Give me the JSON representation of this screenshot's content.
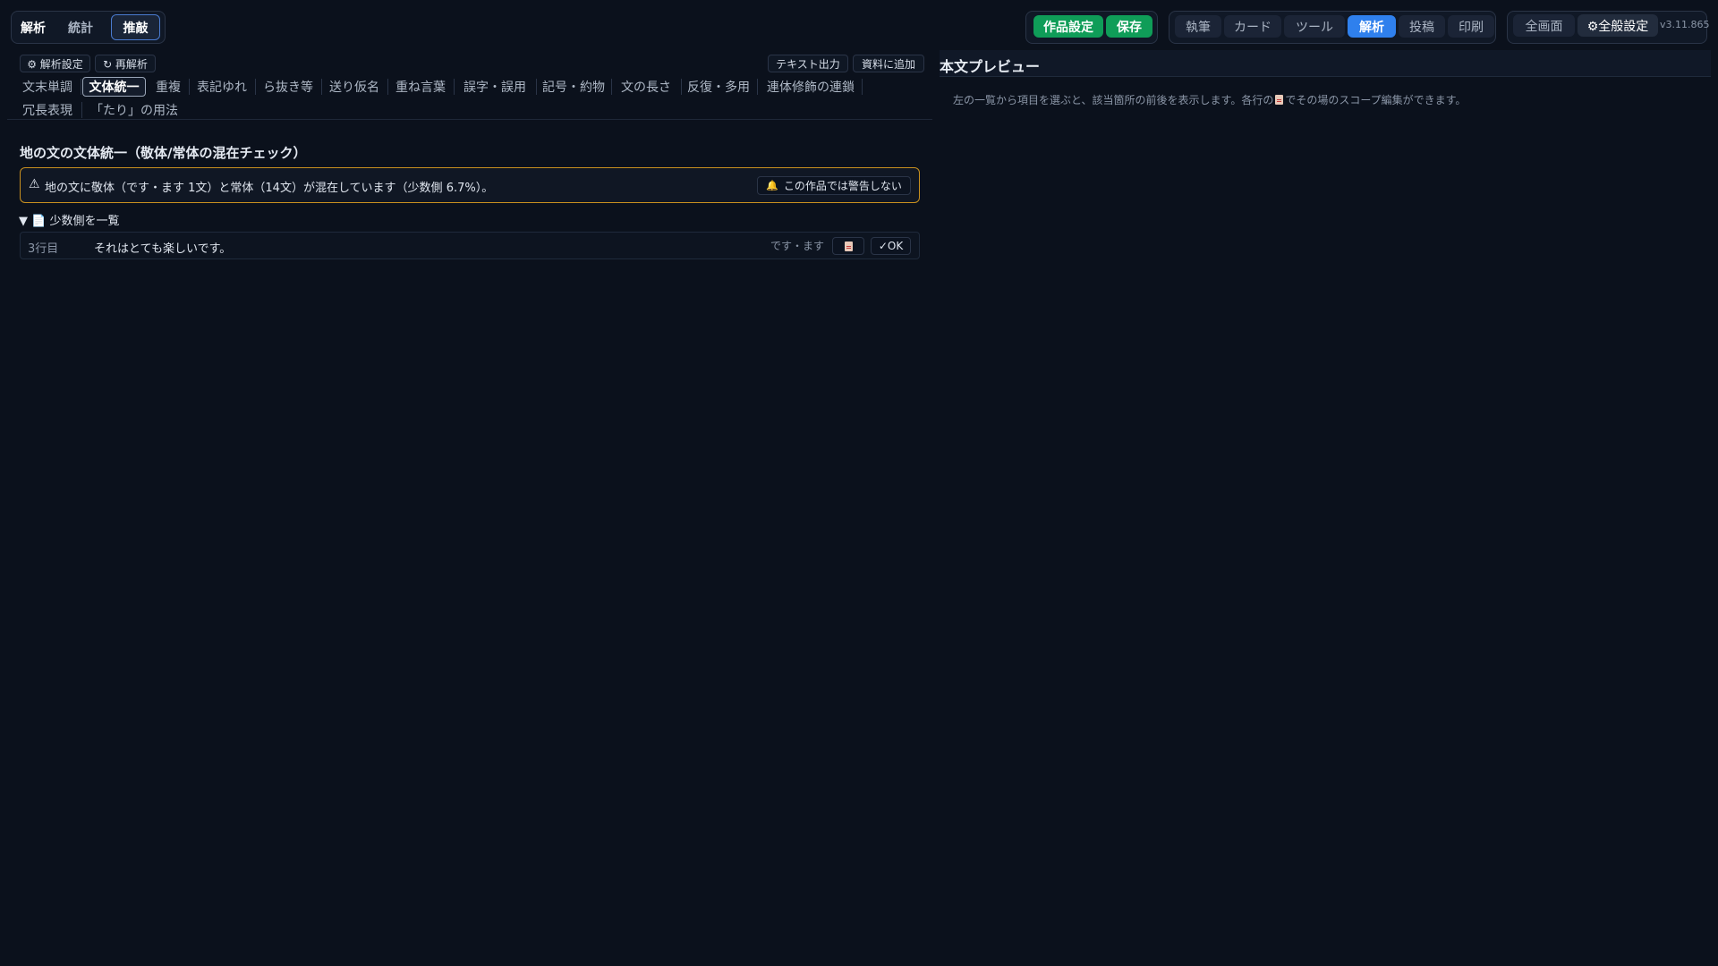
{
  "mode_tabs": [
    {
      "label": "解析"
    },
    {
      "label": "統計"
    },
    {
      "label": "推敲"
    }
  ],
  "header": {
    "work_settings": "作品設定",
    "save": "保存",
    "nav": [
      "執筆",
      "カード",
      "ツール",
      "解析",
      "投稿",
      "印刷"
    ],
    "fullscreen": "全画面",
    "global_settings": "⚙全般設定",
    "version": "v3.11.865"
  },
  "toolbar": {
    "analysis_settings": "⚙ 解析設定",
    "reanalyze": "↻ 再解析",
    "text_export": "テキスト出力",
    "add_to_materials": "資料に追加"
  },
  "check_tabs_row1": [
    "文末単調",
    "文体統一",
    "重複",
    "表記ゆれ",
    "ら抜き等",
    "送り仮名",
    "重ね言葉",
    "誤字・誤用",
    "記号・約物",
    "文の長さ",
    "反復・多用",
    "連体修飾の連鎖"
  ],
  "check_tabs_row2": [
    "冗長表現",
    "「たり」の用法"
  ],
  "section": {
    "title": "地の文の文体統一（敬体/常体の混在チェック）",
    "warning_text": "地の文に敬体（です・ます 1文）と常体（14文）が混在しています（少数側 6.7%）。",
    "mute_button": "この作品では警告しない",
    "minority_toggle": "▼ 📄 少数側を一覧",
    "rows": [
      {
        "line": "3行目",
        "text": "それはとても楽しいです。",
        "style": "です・ます",
        "ok": "✓OK"
      }
    ]
  },
  "preview": {
    "title": "本文プレビュー",
    "hint_before": "左の一覧から項目を選ぶと、該当箇所の前後を表示します。各行の",
    "hint_after": "でその場のスコープ編集ができます。"
  },
  "colors": {
    "background": "#0b111c",
    "accent_green": "#0f9d58",
    "accent_blue": "#2f80ed",
    "warning_border": "#c8901f"
  }
}
